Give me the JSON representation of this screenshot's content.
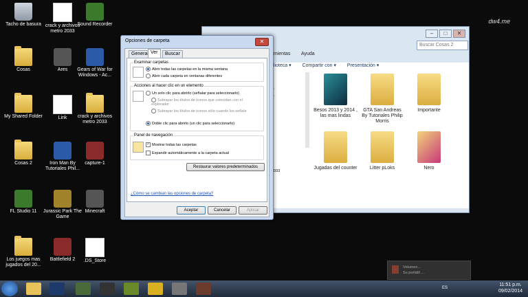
{
  "watermark": "dw4.me",
  "desktop_icons": [
    {
      "label": "Tacho de basura",
      "type": "bin"
    },
    {
      "label": "crack y archivos metro 2033",
      "type": "doc"
    },
    {
      "label": "Sound Recorder",
      "type": "app"
    },
    {
      "label": "Cosas",
      "type": "folder"
    },
    {
      "label": "Ares",
      "type": "app"
    },
    {
      "label": "Gears of War for Windows - Ac...",
      "type": "app"
    },
    {
      "label": "My Shared Folder",
      "type": "folder"
    },
    {
      "label": "Link",
      "type": "doc"
    },
    {
      "label": "crack y archivos metro 2033",
      "type": "folder"
    },
    {
      "label": "Cosas 2",
      "type": "folder"
    },
    {
      "label": "Iron Man By Tutoriales Phil...",
      "type": "app"
    },
    {
      "label": "capture-1",
      "type": "app"
    },
    {
      "label": "FL Studio 11",
      "type": "app"
    },
    {
      "label": "Jurassic Park The Game",
      "type": "app"
    },
    {
      "label": "Minecraft",
      "type": "app"
    },
    {
      "label": "Los juegos mas jugados del 20...",
      "type": "folder"
    },
    {
      "label": "Battlefield 2",
      "type": "app"
    },
    {
      "label": ".DS_Store",
      "type": "doc"
    }
  ],
  "explorer": {
    "search_placeholder": "Buscar Cosas 2",
    "menu": [
      "amientas",
      "Ayuda"
    ],
    "commands": [
      "blioteca ▾",
      "Compartir con ▾",
      "Presentación ▾"
    ],
    "side_text": [
      "s)",
      "s)",
      "033"
    ],
    "items": [
      "Besos 2013 y 2014 , las mas lindas",
      "GTA San Andreas By Tutoriales Philip Morris",
      "Importante",
      "Jugadas del counter",
      "Litter pLoks",
      "Nero"
    ]
  },
  "dialog": {
    "title": "Opciones de carpeta",
    "close": "✕",
    "tabs": [
      "General",
      "Ver",
      "Buscar"
    ],
    "group1": {
      "label": "Examinar carpetas",
      "opt1": "Abrir todas las carpetas en la misma ventana",
      "opt2": "Abrir cada carpeta en ventanas diferentes"
    },
    "group2": {
      "label": "Acciones al hacer clic en un elemento",
      "opt1": "Un solo clic para abrirlo (señalar para seleccionarlo)",
      "sub1": "Subrayar los títulos de iconos que coincidan con el explorador",
      "sub2": "Subrayar los títulos de iconos sólo cuando los señale",
      "opt2": "Doble clic para abrirlo (un clic para seleccionarlo)"
    },
    "group3": {
      "label": "Panel de navegación",
      "chk1": "Mostrar todas las carpetas",
      "chk2": "Expandir automáticamente a la carpeta actual"
    },
    "restore": "Restaurar valores predeterminados",
    "help_link": "¿Cómo se cambian las opciones de carpeta?",
    "ok": "Aceptar",
    "cancel": "Cancelar",
    "apply": "Aplicar"
  },
  "tray": {
    "lang": "ES",
    "time": "11:51 p.m.",
    "date": "09/02/2014"
  },
  "tooltip": {
    "line1": "Volumen...",
    "line2": "Su portátil ..."
  }
}
